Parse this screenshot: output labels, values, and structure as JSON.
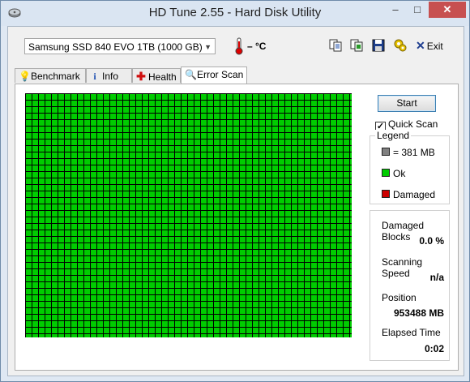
{
  "window": {
    "title": "HD Tune 2.55 - Hard Disk Utility",
    "minimize_glyph": "–",
    "maximize_glyph": "□",
    "close_glyph": "✕"
  },
  "toolbar": {
    "drive": "Samsung SSD 840 EVO 1TB (1000 GB)",
    "temperature": "– °C",
    "exit_label": "Exit",
    "icons": [
      "copy-text-icon",
      "copy-info-icon",
      "save-icon",
      "options-icon",
      "exit-icon"
    ]
  },
  "tabs": [
    {
      "label": "Benchmark",
      "icon": "bulb-icon",
      "active": false
    },
    {
      "label": "Info",
      "icon": "info-icon",
      "active": false
    },
    {
      "label": "Health",
      "icon": "health-cross-icon",
      "active": false
    },
    {
      "label": "Error Scan",
      "icon": "magnifier-icon",
      "active": true
    }
  ],
  "scan": {
    "start_label": "Start",
    "quick_scan_label": "Quick Scan",
    "quick_scan_checked": true,
    "block_colors": {
      "ok": "#00cc00",
      "damaged": "#cc0000",
      "grid_line": "#000000",
      "untested": "#808080"
    },
    "all_blocks_ok": true
  },
  "legend": {
    "title": "Legend",
    "items": [
      {
        "label": "= 381 MB",
        "color": "#808080"
      },
      {
        "label": "Ok",
        "color": "#00cc00"
      },
      {
        "label": "Damaged",
        "color": "#cc0000"
      }
    ]
  },
  "stats": {
    "damaged_blocks_label": "Damaged Blocks",
    "damaged_blocks_value": "0.0 %",
    "scanning_speed_label": "Scanning Speed",
    "scanning_speed_value": "n/a",
    "position_label": "Position",
    "position_value": "953488 MB",
    "elapsed_label": "Elapsed Time",
    "elapsed_value": "0:02"
  }
}
